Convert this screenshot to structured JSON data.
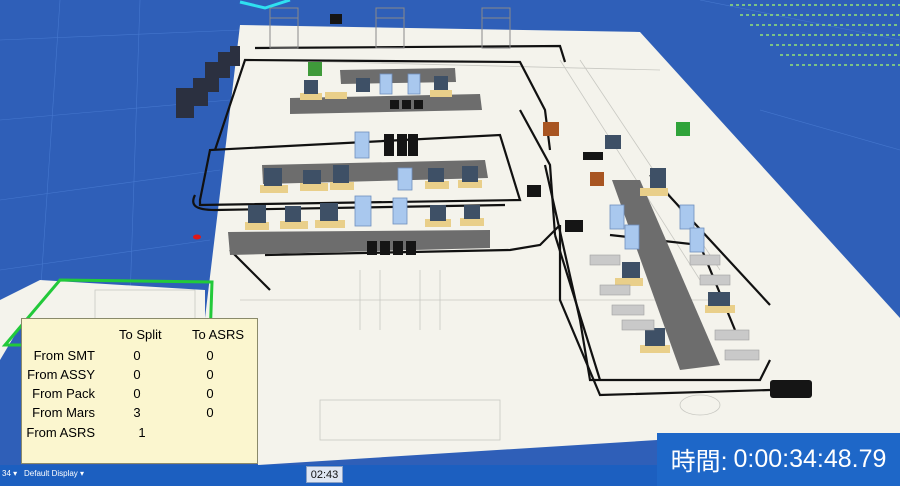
{
  "stats_panel": {
    "col_headers": [
      "To Split",
      "To ASRS"
    ],
    "rows": [
      {
        "label": "From SMT",
        "to_split": "0",
        "to_asrs": "0"
      },
      {
        "label": "From ASSY",
        "to_split": "0",
        "to_asrs": "0"
      },
      {
        "label": "From Pack",
        "to_split": "0",
        "to_asrs": "0"
      },
      {
        "label": "From Mars",
        "to_split": "3",
        "to_asrs": "0"
      },
      {
        "label": "From ASRS",
        "to_split": "1",
        "to_asrs": ""
      }
    ]
  },
  "timer": {
    "label": "時間:",
    "value": "0:00:34:48.79"
  },
  "statusbar": {
    "fragment": "34 ▾",
    "display_menu": "Default Display ▾",
    "clock": "02:43"
  },
  "colors": {
    "background_blue": "#2f5fb8",
    "floor": "#f4f3ec",
    "conveyor": "#6d6d6d",
    "panel_bg": "#fbf6cf",
    "timer_bg": "#1e67c8",
    "zone_green": "#22c93a",
    "edge_cyan": "#2fe0f0"
  }
}
